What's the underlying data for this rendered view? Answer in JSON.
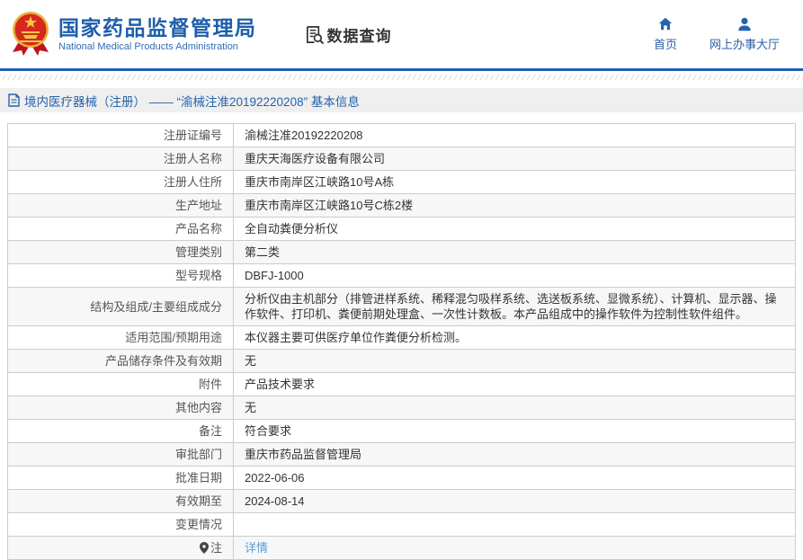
{
  "header": {
    "org_title": "国家药品监督管理局",
    "org_subtitle": "National Medical Products Administration",
    "data_query_label": "数据查询",
    "nav": [
      {
        "label": "首页",
        "icon": "home-icon"
      },
      {
        "label": "网上办事大厅",
        "icon": "person-icon"
      }
    ]
  },
  "breadcrumb": {
    "text": "境内医疗器械（注册） —— “渝械注准20192220208” 基本信息"
  },
  "table": {
    "rows": [
      {
        "label": "注册证编号",
        "value": "渝械注准20192220208"
      },
      {
        "label": "注册人名称",
        "value": "重庆天海医疗设备有限公司"
      },
      {
        "label": "注册人住所",
        "value": "重庆市南岸区江峡路10号A栋"
      },
      {
        "label": "生产地址",
        "value": "重庆市南岸区江峡路10号C栋2楼"
      },
      {
        "label": "产品名称",
        "value": "全自动粪便分析仪"
      },
      {
        "label": "管理类别",
        "value": "第二类"
      },
      {
        "label": "型号规格",
        "value": "DBFJ-1000"
      },
      {
        "label": "结构及组成/主要组成成分",
        "value": "分析仪由主机部分（排管进样系统、稀释混匀吸样系统、选送板系统、显微系统）、计算机、显示器、操作软件、打印机、粪便前期处理盒、一次性计数板。本产品组成中的操作软件为控制性软件组件。"
      },
      {
        "label": "适用范围/预期用途",
        "value": "本仪器主要可供医疗单位作粪便分析检测。"
      },
      {
        "label": "产品储存条件及有效期",
        "value": "无"
      },
      {
        "label": "附件",
        "value": "产品技术要求"
      },
      {
        "label": "其他内容",
        "value": "无"
      },
      {
        "label": "备注",
        "value": "符合要求"
      },
      {
        "label": "审批部门",
        "value": "重庆市药品监督管理局"
      },
      {
        "label": "批准日期",
        "value": "2022-06-06"
      },
      {
        "label": "有效期至",
        "value": "2024-08-14"
      },
      {
        "label": "变更情况",
        "value": ""
      },
      {
        "label": "注",
        "value": "详情",
        "value_type": "link",
        "label_icon": "pin-icon"
      }
    ]
  },
  "colors": {
    "brand_blue": "#1f5eab",
    "nav_blue": "#2b5fa7",
    "divider_blue": "#2061b0",
    "breadcrumb_bg": "#efefef",
    "breadcrumb_text": "#2563ab",
    "table_border": "#cccccc",
    "alt_row_bg": "#f7f7f7",
    "link_blue": "#5b9bd5",
    "emblem_red": "#d5281e",
    "emblem_gold": "#e8b33a"
  }
}
